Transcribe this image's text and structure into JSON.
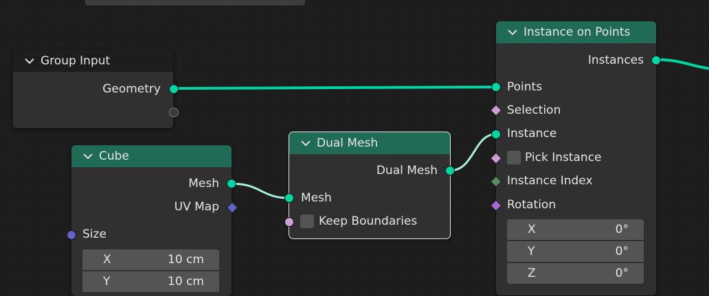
{
  "nodes": {
    "group_input": {
      "title": "Group Input",
      "geometry_label": "Geometry"
    },
    "instance_on_points": {
      "title": "Instance on Points",
      "instances_label": "Instances",
      "points_label": "Points",
      "selection_label": "Selection",
      "instance_label": "Instance",
      "pick_instance_label": "Pick Instance",
      "instance_index_label": "Instance Index",
      "rotation_label": "Rotation",
      "rotation": [
        {
          "axis": "X",
          "value": "0°"
        },
        {
          "axis": "Y",
          "value": "0°"
        },
        {
          "axis": "Z",
          "value": "0°"
        }
      ]
    },
    "dual_mesh": {
      "title": "Dual Mesh",
      "dual_mesh_label": "Dual Mesh",
      "mesh_label": "Mesh",
      "keep_boundaries_label": "Keep Boundaries"
    },
    "cube": {
      "title": "Cube",
      "mesh_label": "Mesh",
      "uvmap_label": "UV Map",
      "size_label": "Size",
      "size": [
        {
          "axis": "X",
          "value": "10 cm"
        },
        {
          "axis": "Y",
          "value": "10 cm"
        }
      ]
    }
  },
  "colors": {
    "geometry_socket": "#00d6a3",
    "node_header": "#1f6b57",
    "vector_socket": "#6363c7"
  }
}
